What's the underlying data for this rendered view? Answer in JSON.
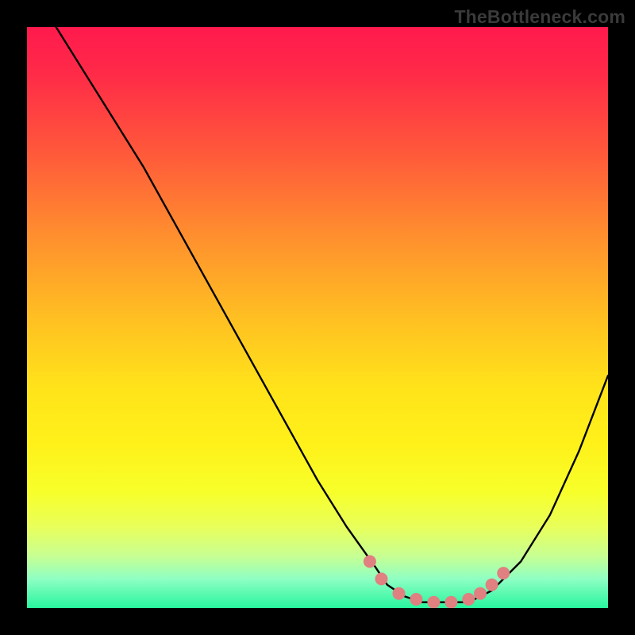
{
  "watermark": {
    "text": "TheBottleneck.com"
  },
  "chart_data": {
    "type": "line",
    "title": "",
    "xlabel": "",
    "ylabel": "",
    "xlim": [
      0,
      100
    ],
    "ylim": [
      0,
      100
    ],
    "series": [
      {
        "name": "bottleneck-curve",
        "x": [
          5,
          10,
          15,
          20,
          25,
          30,
          35,
          40,
          45,
          50,
          55,
          60,
          62,
          65,
          68,
          72,
          76,
          80,
          85,
          90,
          95,
          100
        ],
        "y": [
          100,
          92,
          84,
          76,
          67,
          58,
          49,
          40,
          31,
          22,
          14,
          7,
          4,
          2,
          1,
          1,
          1,
          3,
          8,
          16,
          27,
          40
        ]
      }
    ],
    "highlight": {
      "name": "optimal-range-markers",
      "color": "#e08080",
      "points": [
        {
          "x": 59,
          "y": 8
        },
        {
          "x": 61,
          "y": 5
        },
        {
          "x": 64,
          "y": 2.5
        },
        {
          "x": 67,
          "y": 1.5
        },
        {
          "x": 70,
          "y": 1
        },
        {
          "x": 73,
          "y": 1
        },
        {
          "x": 76,
          "y": 1.5
        },
        {
          "x": 78,
          "y": 2.5
        },
        {
          "x": 80,
          "y": 4
        },
        {
          "x": 82,
          "y": 6
        }
      ]
    },
    "background_gradient": {
      "top": "#ff1a4d",
      "mid": "#ffe31a",
      "bottom": "#28f59f"
    }
  }
}
